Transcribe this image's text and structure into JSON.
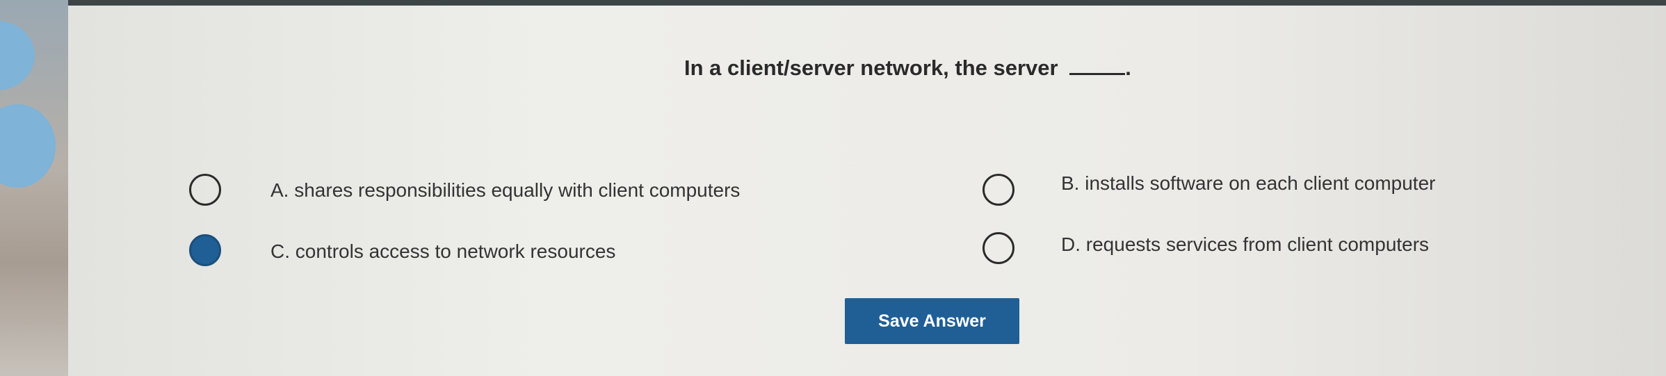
{
  "question": {
    "text": "In a client/server network, the server",
    "suffix": "."
  },
  "options": [
    {
      "label": "A. shares responsibilities equally with client computers",
      "selected": false
    },
    {
      "label": "B. installs software on each client computer",
      "selected": false
    },
    {
      "label": "C. controls access to network resources",
      "selected": true
    },
    {
      "label": "D. requests services from client computers",
      "selected": false
    }
  ],
  "actions": {
    "save_label": "Save Answer"
  },
  "colors": {
    "accent": "#1f5f95",
    "background": "#eeeeea",
    "text": "#333333"
  }
}
